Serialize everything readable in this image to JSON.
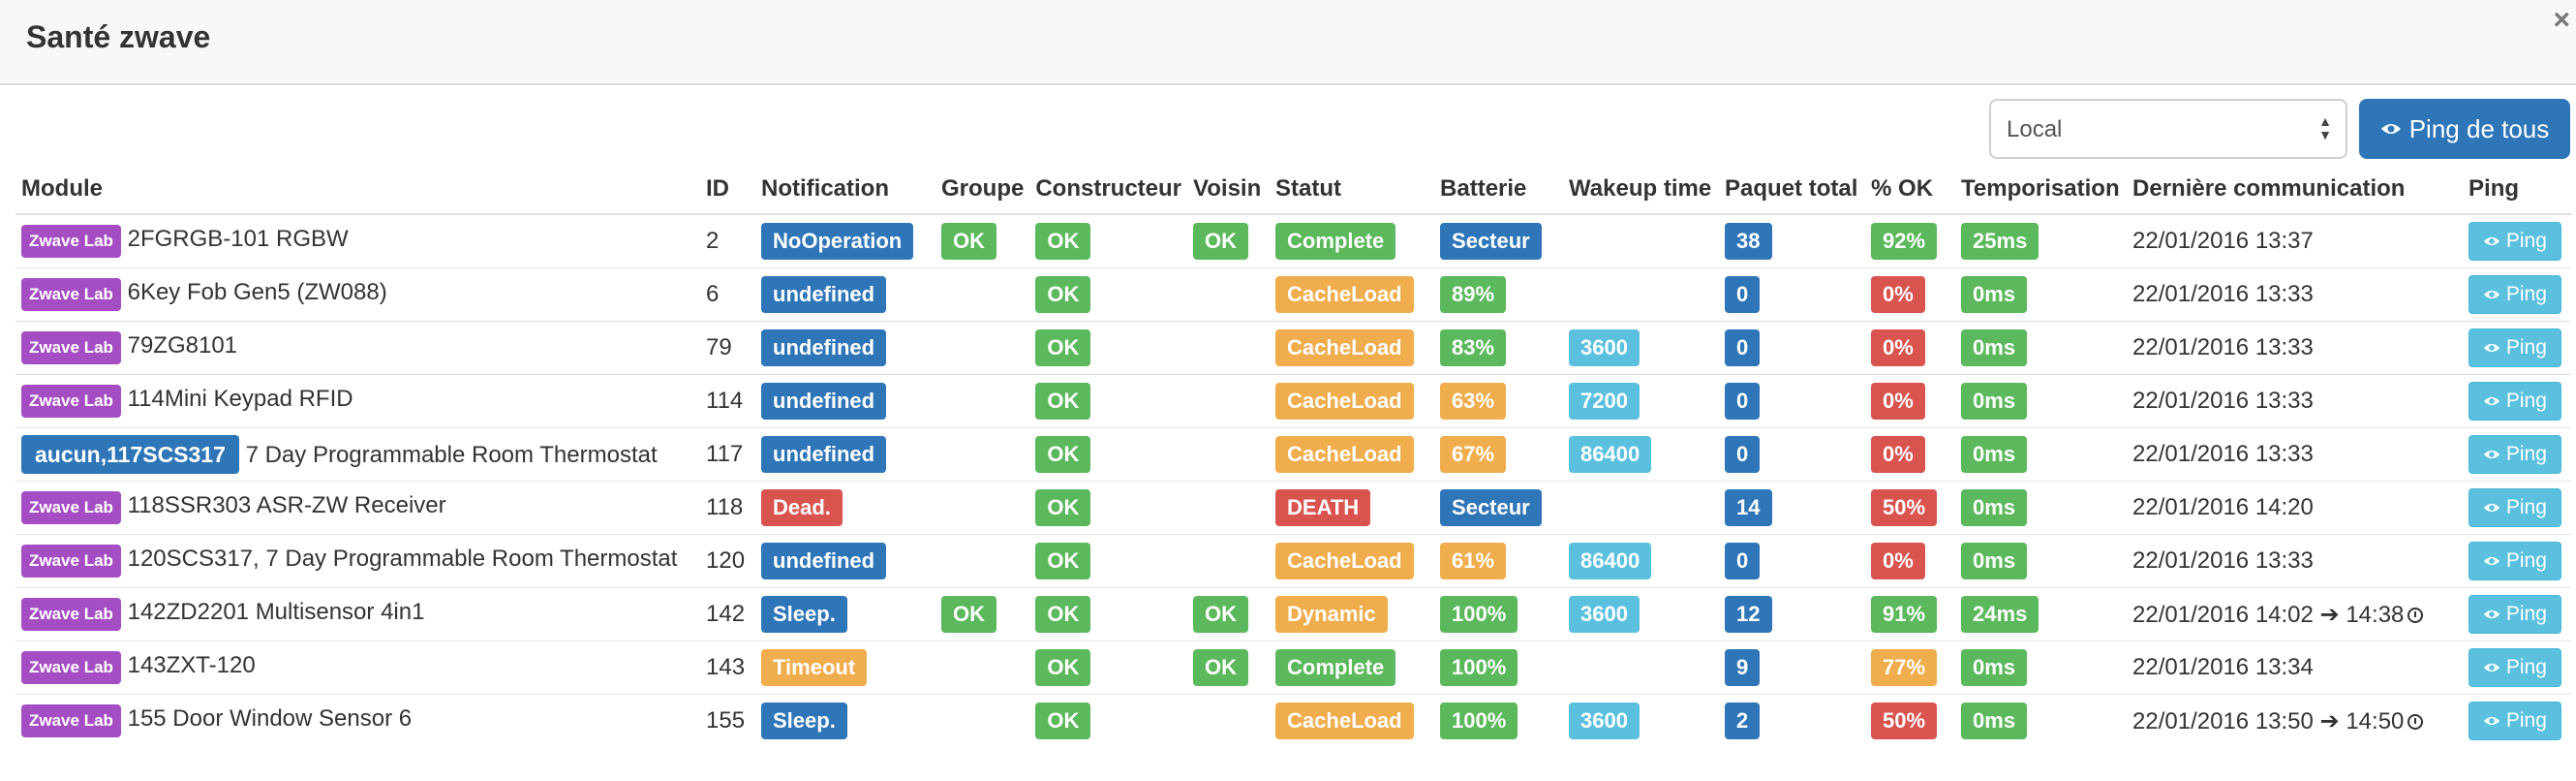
{
  "modal": {
    "title": "Santé zwave",
    "close_glyph": "×"
  },
  "toolbar": {
    "select_value": "Local",
    "ping_all_label": "Ping de tous"
  },
  "columns": [
    "Module",
    "ID",
    "Notification",
    "Groupe",
    "Constructeur",
    "Voisin",
    "Statut",
    "Batterie",
    "Wakeup time",
    "Paquet total",
    "% OK",
    "Temporisation",
    "Dernière communication",
    "Ping"
  ],
  "ping_label": "Ping",
  "rows": [
    {
      "tag": "Zwave Lab",
      "tag_style": "purple",
      "module": "2FGRGB-101 RGBW",
      "id": "2",
      "notif": "NoOperation",
      "notif_color": "blue",
      "groupe": "OK",
      "constructeur": "OK",
      "voisin": "OK",
      "statut": "Complete",
      "statut_color": "green",
      "batterie": "Secteur",
      "batterie_color": "blue",
      "wakeup": "",
      "paquet": "38",
      "pct": "92%",
      "pct_color": "green",
      "tempo": "25ms",
      "last": "22/01/2016 13:37",
      "last2": ""
    },
    {
      "tag": "Zwave Lab",
      "tag_style": "purple",
      "module": "6Key Fob Gen5 (ZW088)",
      "id": "6",
      "notif": "undefined",
      "notif_color": "blue",
      "groupe": "",
      "constructeur": "OK",
      "voisin": "",
      "statut": "CacheLoad",
      "statut_color": "orange",
      "batterie": "89%",
      "batterie_color": "green",
      "wakeup": "",
      "paquet": "0",
      "pct": "0%",
      "pct_color": "red",
      "tempo": "0ms",
      "last": "22/01/2016 13:33",
      "last2": ""
    },
    {
      "tag": "Zwave Lab",
      "tag_style": "purple",
      "module": "79ZG8101",
      "id": "79",
      "notif": "undefined",
      "notif_color": "blue",
      "groupe": "",
      "constructeur": "OK",
      "voisin": "",
      "statut": "CacheLoad",
      "statut_color": "orange",
      "batterie": "83%",
      "batterie_color": "green",
      "wakeup": "3600",
      "paquet": "0",
      "pct": "0%",
      "pct_color": "red",
      "tempo": "0ms",
      "last": "22/01/2016 13:33",
      "last2": ""
    },
    {
      "tag": "Zwave Lab",
      "tag_style": "purple",
      "module": "114Mini Keypad RFID",
      "id": "114",
      "notif": "undefined",
      "notif_color": "blue",
      "groupe": "",
      "constructeur": "OK",
      "voisin": "",
      "statut": "CacheLoad",
      "statut_color": "orange",
      "batterie": "63%",
      "batterie_color": "orange",
      "wakeup": "7200",
      "paquet": "0",
      "pct": "0%",
      "pct_color": "red",
      "tempo": "0ms",
      "last": "22/01/2016 13:33",
      "last2": ""
    },
    {
      "tag": "aucun,117SCS317",
      "tag_style": "wide",
      "module": "7 Day Programmable Room Thermostat",
      "id": "117",
      "notif": "undefined",
      "notif_color": "blue",
      "groupe": "",
      "constructeur": "OK",
      "voisin": "",
      "statut": "CacheLoad",
      "statut_color": "orange",
      "batterie": "67%",
      "batterie_color": "orange",
      "wakeup": "86400",
      "paquet": "0",
      "pct": "0%",
      "pct_color": "red",
      "tempo": "0ms",
      "last": "22/01/2016 13:33",
      "last2": ""
    },
    {
      "tag": "Zwave Lab",
      "tag_style": "purple",
      "module": "118SSR303 ASR-ZW Receiver",
      "id": "118",
      "notif": "Dead.",
      "notif_color": "red",
      "groupe": "",
      "constructeur": "OK",
      "voisin": "",
      "statut": "DEATH",
      "statut_color": "red",
      "batterie": "Secteur",
      "batterie_color": "blue",
      "wakeup": "",
      "paquet": "14",
      "pct": "50%",
      "pct_color": "red",
      "tempo": "0ms",
      "last": "22/01/2016 14:20",
      "last2": ""
    },
    {
      "tag": "Zwave Lab",
      "tag_style": "purple",
      "module": "120SCS317, 7 Day Programmable Room Thermostat",
      "id": "120",
      "notif": "undefined",
      "notif_color": "blue",
      "groupe": "",
      "constructeur": "OK",
      "voisin": "",
      "statut": "CacheLoad",
      "statut_color": "orange",
      "batterie": "61%",
      "batterie_color": "orange",
      "wakeup": "86400",
      "paquet": "0",
      "pct": "0%",
      "pct_color": "red",
      "tempo": "0ms",
      "last": "22/01/2016 13:33",
      "last2": ""
    },
    {
      "tag": "Zwave Lab",
      "tag_style": "purple",
      "module": "142ZD2201 Multisensor 4in1",
      "id": "142",
      "notif": "Sleep.",
      "notif_color": "blue",
      "groupe": "OK",
      "constructeur": "OK",
      "voisin": "OK",
      "statut": "Dynamic",
      "statut_color": "orange",
      "batterie": "100%",
      "batterie_color": "green",
      "wakeup": "3600",
      "paquet": "12",
      "pct": "91%",
      "pct_color": "green",
      "tempo": "24ms",
      "last": "22/01/2016 14:02",
      "last2": "14:38"
    },
    {
      "tag": "Zwave Lab",
      "tag_style": "purple",
      "module": "143ZXT-120",
      "id": "143",
      "notif": "Timeout",
      "notif_color": "orange",
      "groupe": "",
      "constructeur": "OK",
      "voisin": "OK",
      "statut": "Complete",
      "statut_color": "green",
      "batterie": "100%",
      "batterie_color": "green",
      "wakeup": "",
      "paquet": "9",
      "pct": "77%",
      "pct_color": "orange",
      "tempo": "0ms",
      "last": "22/01/2016 13:34",
      "last2": ""
    },
    {
      "tag": "Zwave Lab",
      "tag_style": "purple",
      "module": "155 Door Window Sensor 6",
      "id": "155",
      "notif": "Sleep.",
      "notif_color": "blue",
      "groupe": "",
      "constructeur": "OK",
      "voisin": "",
      "statut": "CacheLoad",
      "statut_color": "orange",
      "batterie": "100%",
      "batterie_color": "green",
      "wakeup": "3600",
      "paquet": "2",
      "pct": "50%",
      "pct_color": "red",
      "tempo": "0ms",
      "last": "22/01/2016 13:50",
      "last2": "14:50"
    }
  ]
}
